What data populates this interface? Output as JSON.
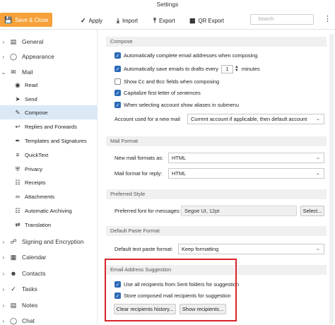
{
  "window": {
    "title": "Settings"
  },
  "toolbar": {
    "save_close": "Save & Close",
    "apply": "Apply",
    "import": "Import",
    "export": "Export",
    "qr_export": "QR Export",
    "search_placeholder": "Search",
    "more": "⋮"
  },
  "sidebar": {
    "sections": [
      {
        "label": "General",
        "chevron": "›",
        "icon": "general-icon"
      },
      {
        "label": "Appearance",
        "chevron": "›",
        "icon": "appearance-icon"
      },
      {
        "label": "Mail",
        "chevron": "⌄",
        "icon": "mail-icon"
      }
    ],
    "mail_items": [
      {
        "label": "Read",
        "icon": "eye-icon"
      },
      {
        "label": "Send",
        "icon": "send-icon"
      },
      {
        "label": "Compose",
        "icon": "pencil-icon",
        "active": true
      },
      {
        "label": "Replies and Forwards",
        "icon": "reply-icon"
      },
      {
        "label": "Templates and Signatures",
        "icon": "signature-icon"
      },
      {
        "label": "QuickText",
        "icon": "quicktext-icon"
      },
      {
        "label": "Privacy",
        "icon": "shield-icon"
      },
      {
        "label": "Receipts",
        "icon": "receipt-icon"
      },
      {
        "label": "Attachments",
        "icon": "paperclip-icon"
      },
      {
        "label": "Automatic Archiving",
        "icon": "archive-icon"
      },
      {
        "label": "Translation",
        "icon": "translation-icon"
      }
    ],
    "bottom_sections": [
      {
        "label": "Signing and Encryption",
        "icon": "lock-icon"
      },
      {
        "label": "Calendar",
        "icon": "calendar-icon"
      },
      {
        "label": "Contacts",
        "icon": "contacts-icon"
      },
      {
        "label": "Tasks",
        "icon": "tasks-icon"
      },
      {
        "label": "Notes",
        "icon": "notes-icon"
      },
      {
        "label": "Chat",
        "icon": "chat-icon"
      }
    ]
  },
  "compose": {
    "header": "Compose",
    "auto_complete": "Automatically complete email addresses when composing",
    "auto_save_prefix": "Automatically save emails to drafts every",
    "auto_save_value": "1",
    "auto_save_suffix": "minutes",
    "show_cc_bcc": "Show Cc and Bcc fields when composing",
    "capitalize": "Capitalize first letter of sentences",
    "show_aliases": "When selecting account show aliases in submenu",
    "account_label": "Account used for a new mail",
    "account_value": "Current account if applicable, then default account"
  },
  "mail_format": {
    "header": "Mail Format",
    "new_label": "New mail formats as:",
    "new_value": "HTML",
    "reply_label": "Mail format for reply:",
    "reply_value": "HTML"
  },
  "preferred_style": {
    "header": "Preferred Style",
    "font_label": "Preferred font for messages:",
    "font_value": "Segoe UI, 12pt",
    "select_button": "Select..."
  },
  "paste_format": {
    "header": "Default Paste Format",
    "label": "Default text paste format:",
    "value": "Keep formatting"
  },
  "address_suggestion": {
    "header": "Email Address Suggestion",
    "use_sent": "Use all recipients from Sent folders for suggestion",
    "store_composed": "Store composed mail recipients for suggestion",
    "clear_button": "Clear recipients history...",
    "show_button": "Show recipients..."
  },
  "colors": {
    "accent": "#f6a13a",
    "checkbox": "#2a6ab8",
    "highlight": "#d8232a",
    "active_item": "#dbe9f7"
  }
}
